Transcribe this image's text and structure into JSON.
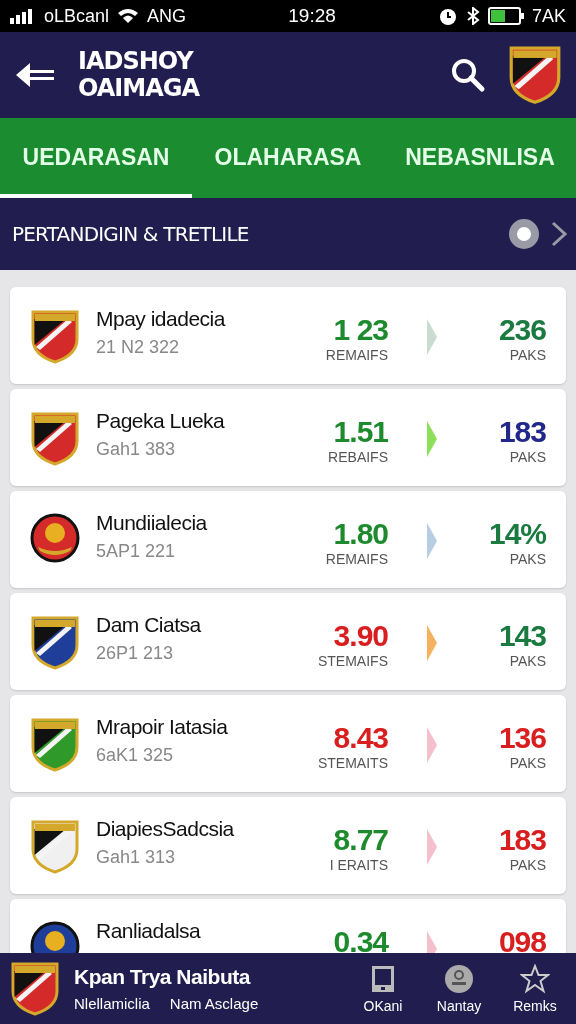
{
  "status_bar": {
    "carrier": "oLBcanl",
    "network": "ANG",
    "time": "19:28",
    "battery_text": "7AK"
  },
  "header": {
    "title_lines": [
      "IADSHOY",
      "OAIMAGA"
    ]
  },
  "tabs": [
    {
      "label": "UEDARASAN",
      "selected": true
    },
    {
      "label": "OLAHARASA",
      "selected": false
    },
    {
      "label": "NEBASNLISA",
      "selected": false
    }
  ],
  "section": {
    "title": "PERTANDIGIN & TRETLILE"
  },
  "matches": [
    {
      "name": "Mpay idadecia",
      "code": "21 N2 322",
      "value": {
        "text": "1 23",
        "color": "#1e8a2e"
      },
      "value_label": "REMAIFS",
      "arrow": {
        "color": "#c8dcd0"
      },
      "total": {
        "text": "236",
        "color": "#1a7a40"
      },
      "total_label": "PAKS",
      "crest": {
        "kind": "shield",
        "color": "#d42a2a"
      }
    },
    {
      "name": "Pageka Lueka",
      "code": "Gah1 383",
      "value": {
        "text": "1.51",
        "color": "#1e8a2e"
      },
      "value_label": "REBAIFS",
      "arrow": {
        "color": "#8ee05a"
      },
      "total": {
        "text": "183",
        "color": "#22288a"
      },
      "total_label": "PAKS",
      "crest": {
        "kind": "shield",
        "color": "#d42a2a"
      }
    },
    {
      "name": "Mundiialecia",
      "code": "5AP1 221",
      "value": {
        "text": "1.80",
        "color": "#1e8a2e"
      },
      "value_label": "REMAIFS",
      "arrow": {
        "color": "#b8cce4"
      },
      "total": {
        "text": "14%",
        "color": "#1a7a40"
      },
      "total_label": "PAKS",
      "crest": {
        "kind": "round",
        "color": "#d42a2a"
      }
    },
    {
      "name": "Dam Ciatsa",
      "code": "26P1 213",
      "value": {
        "text": "3.90",
        "color": "#d81e1e"
      },
      "value_label": "STEMAIFS",
      "arrow": {
        "color": "#f5b060"
      },
      "total": {
        "text": "143",
        "color": "#1a7a40"
      },
      "total_label": "PAKS",
      "crest": {
        "kind": "shield",
        "color": "#1f3e9a"
      }
    },
    {
      "name": "Mrapoir Iatasia",
      "code": "6aK1 325",
      "value": {
        "text": "8.43",
        "color": "#d81e1e"
      },
      "value_label": "STEMAITS",
      "arrow": {
        "color": "#f4c0cc"
      },
      "total": {
        "text": "136",
        "color": "#d81e1e"
      },
      "total_label": "PAKS",
      "crest": {
        "kind": "shield",
        "color": "#2f9a2a"
      }
    },
    {
      "name": "DiapiesSadcsia",
      "code": "Gah1 313",
      "value": {
        "text": "8.77",
        "color": "#1e8a2e"
      },
      "value_label": "I ERAITS",
      "arrow": {
        "color": "#f4c0cc"
      },
      "total": {
        "text": "183",
        "color": "#d81e1e"
      },
      "total_label": "PAKS",
      "crest": {
        "kind": "shield",
        "color": "#f0f0f0"
      }
    },
    {
      "name": "Ranliadalsa",
      "value": {
        "text": "0.34",
        "color": "#1e8a2e"
      },
      "arrow": {
        "color": "#f4c0cc"
      },
      "total": {
        "text": "098",
        "color": "#d81e1e"
      },
      "crest": {
        "kind": "round",
        "color": "#1f3e9a"
      }
    }
  ],
  "bottom_bar": {
    "title": "Kpan Trya Naibuta",
    "subtitles": [
      "Nlellamiclia",
      "Nam Asclage"
    ],
    "nav": [
      {
        "label": "OKani",
        "kind": "tablet"
      },
      {
        "label": "Nantay",
        "kind": "person"
      },
      {
        "label": "Remks",
        "kind": "star"
      }
    ]
  }
}
